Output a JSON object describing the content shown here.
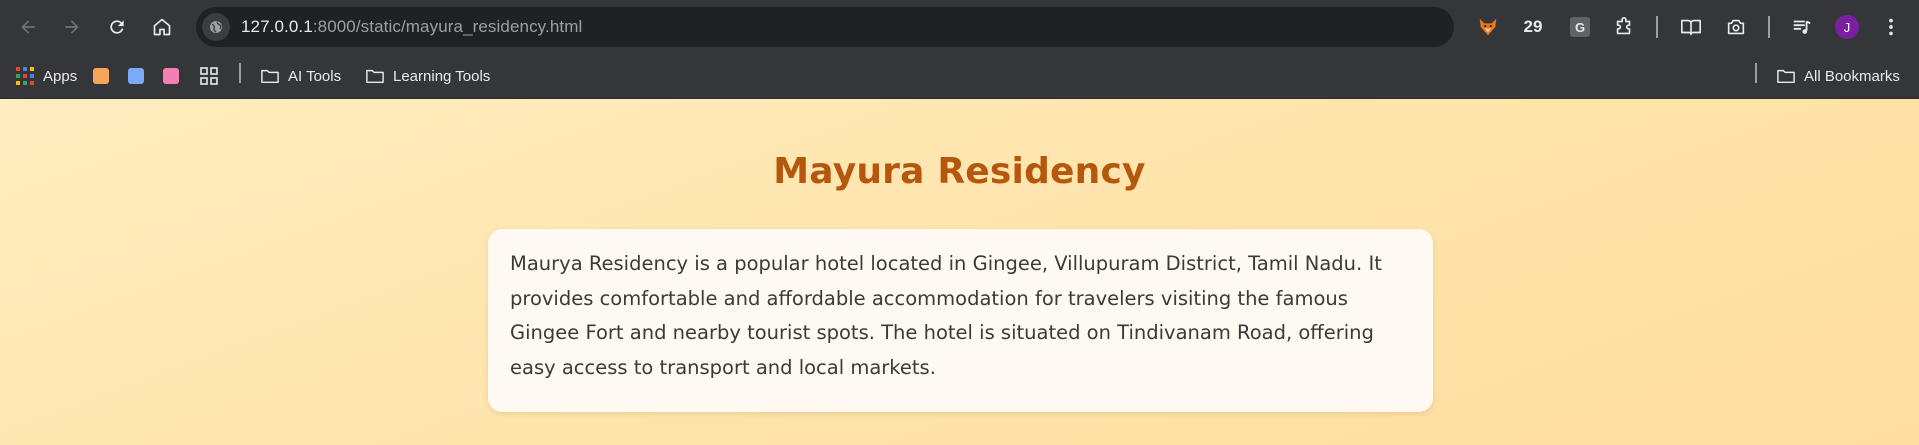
{
  "browser": {
    "url_host": "127.0.0.1",
    "url_path": ":8000/static/mayura_residency.html",
    "extension_count": "29",
    "extension_g_label": "G",
    "profile_initial": "J"
  },
  "bookmarks": {
    "apps_label": "Apps",
    "ai_tools_label": "AI Tools",
    "learning_tools_label": "Learning Tools",
    "all_bookmarks_label": "All Bookmarks"
  },
  "page": {
    "title": "Mayura Residency",
    "description": "Maurya Residency is a popular hotel located in Gingee, Villupuram District, Tamil Nadu. It provides comfortable and affordable accommodation for travelers visiting the famous Gingee Fort and nearby tourist spots. The hotel is situated on Tindivanam Road, offering easy access to transport and local markets."
  },
  "colors": {
    "title": "#b5570c",
    "background": "#ffe4aa",
    "card": "#fffaf1",
    "chrome": "#35363a"
  }
}
